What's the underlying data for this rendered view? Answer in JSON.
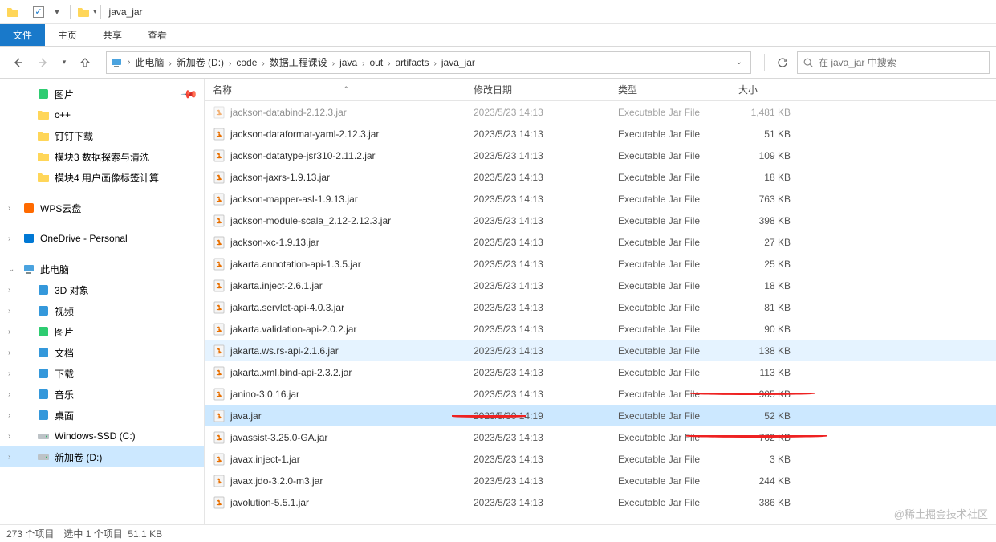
{
  "window": {
    "title": "java_jar"
  },
  "ribbon": {
    "file": "文件",
    "home": "主页",
    "share": "共享",
    "view": "查看"
  },
  "breadcrumb": {
    "items": [
      "此电脑",
      "新加卷 (D:)",
      "code",
      "数据工程课设",
      "java",
      "out",
      "artifacts",
      "java_jar"
    ]
  },
  "search": {
    "placeholder": "在 java_jar 中搜索"
  },
  "nav": {
    "quick": [
      {
        "label": "图片",
        "icon": "pictures",
        "pinned": true
      },
      {
        "label": "c++",
        "icon": "folder"
      },
      {
        "label": "钉钉下载",
        "icon": "folder"
      },
      {
        "label": "模块3 数据探索与清洗",
        "icon": "folder"
      },
      {
        "label": "模块4 用户画像标签计算",
        "icon": "folder"
      }
    ],
    "clouds": [
      {
        "label": "WPS云盘",
        "icon": "wps"
      },
      {
        "label": "OneDrive - Personal",
        "icon": "onedrive"
      }
    ],
    "thispc": {
      "label": "此电脑",
      "expanded": true
    },
    "pcitems": [
      {
        "label": "3D 对象",
        "icon": "3d"
      },
      {
        "label": "视频",
        "icon": "video"
      },
      {
        "label": "图片",
        "icon": "pictures"
      },
      {
        "label": "文档",
        "icon": "docs"
      },
      {
        "label": "下载",
        "icon": "downloads"
      },
      {
        "label": "音乐",
        "icon": "music"
      },
      {
        "label": "桌面",
        "icon": "desktop"
      },
      {
        "label": "Windows-SSD (C:)",
        "icon": "drive"
      },
      {
        "label": "新加卷 (D:)",
        "icon": "drive",
        "selected": true
      }
    ]
  },
  "columns": {
    "name": "名称",
    "date": "修改日期",
    "type": "类型",
    "size": "大小"
  },
  "files": [
    {
      "name": "jackson-databind-2.12.3.jar",
      "date": "2023/5/23 14:13",
      "type": "Executable Jar File",
      "size": "1,481 KB",
      "cut": true
    },
    {
      "name": "jackson-dataformat-yaml-2.12.3.jar",
      "date": "2023/5/23 14:13",
      "type": "Executable Jar File",
      "size": "51 KB"
    },
    {
      "name": "jackson-datatype-jsr310-2.11.2.jar",
      "date": "2023/5/23 14:13",
      "type": "Executable Jar File",
      "size": "109 KB"
    },
    {
      "name": "jackson-jaxrs-1.9.13.jar",
      "date": "2023/5/23 14:13",
      "type": "Executable Jar File",
      "size": "18 KB"
    },
    {
      "name": "jackson-mapper-asl-1.9.13.jar",
      "date": "2023/5/23 14:13",
      "type": "Executable Jar File",
      "size": "763 KB"
    },
    {
      "name": "jackson-module-scala_2.12-2.12.3.jar",
      "date": "2023/5/23 14:13",
      "type": "Executable Jar File",
      "size": "398 KB"
    },
    {
      "name": "jackson-xc-1.9.13.jar",
      "date": "2023/5/23 14:13",
      "type": "Executable Jar File",
      "size": "27 KB"
    },
    {
      "name": "jakarta.annotation-api-1.3.5.jar",
      "date": "2023/5/23 14:13",
      "type": "Executable Jar File",
      "size": "25 KB"
    },
    {
      "name": "jakarta.inject-2.6.1.jar",
      "date": "2023/5/23 14:13",
      "type": "Executable Jar File",
      "size": "18 KB"
    },
    {
      "name": "jakarta.servlet-api-4.0.3.jar",
      "date": "2023/5/23 14:13",
      "type": "Executable Jar File",
      "size": "81 KB"
    },
    {
      "name": "jakarta.validation-api-2.0.2.jar",
      "date": "2023/5/23 14:13",
      "type": "Executable Jar File",
      "size": "90 KB"
    },
    {
      "name": "jakarta.ws.rs-api-2.1.6.jar",
      "date": "2023/5/23 14:13",
      "type": "Executable Jar File",
      "size": "138 KB",
      "highlight": true
    },
    {
      "name": "jakarta.xml.bind-api-2.3.2.jar",
      "date": "2023/5/23 14:13",
      "type": "Executable Jar File",
      "size": "113 KB"
    },
    {
      "name": "janino-3.0.16.jar",
      "date": "2023/5/23 14:13",
      "type": "Executable Jar File",
      "size": "905 KB"
    },
    {
      "name": "java.jar",
      "date": "2023/5/30 14:19",
      "type": "Executable Jar File",
      "size": "52 KB",
      "selected": true
    },
    {
      "name": "javassist-3.25.0-GA.jar",
      "date": "2023/5/23 14:13",
      "type": "Executable Jar File",
      "size": "762 KB"
    },
    {
      "name": "javax.inject-1.jar",
      "date": "2023/5/23 14:13",
      "type": "Executable Jar File",
      "size": "3 KB"
    },
    {
      "name": "javax.jdo-3.2.0-m3.jar",
      "date": "2023/5/23 14:13",
      "type": "Executable Jar File",
      "size": "244 KB"
    },
    {
      "name": "javolution-5.5.1.jar",
      "date": "2023/5/23 14:13",
      "type": "Executable Jar File",
      "size": "386 KB"
    }
  ],
  "status": {
    "count": "273 个项目",
    "selection": "选中 1 个项目",
    "size": "51.1 KB"
  },
  "watermark": "@稀土掘金技术社区"
}
